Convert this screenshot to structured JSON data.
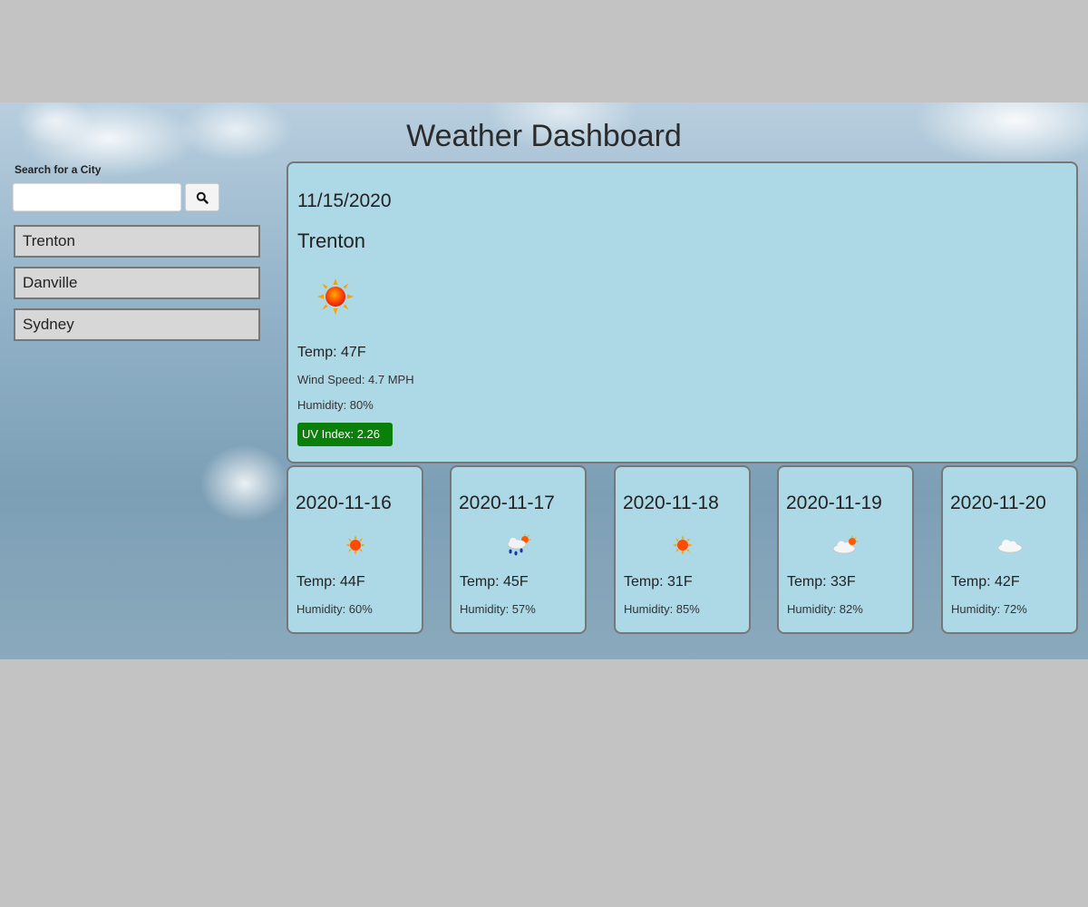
{
  "header": {
    "title": "Weather Dashboard"
  },
  "search": {
    "label": "Search for a City",
    "value": "",
    "placeholder": ""
  },
  "history": [
    "Trenton",
    "Danville",
    "Sydney"
  ],
  "current": {
    "date": "11/15/2020",
    "city": "Trenton",
    "icon": "sun-icon",
    "temp": "Temp: 47F",
    "wind": "Wind Speed: 4.7 MPH",
    "humidity": "Humidity: 80%",
    "uv": "UV Index: 2.26",
    "uv_color": "#0a7f0a"
  },
  "forecast": [
    {
      "date": "2020-11-16",
      "icon": "sun-icon",
      "temp": "Temp: 44F",
      "humidity": "Humidity: 60%"
    },
    {
      "date": "2020-11-17",
      "icon": "rain-cloud-sun-icon",
      "temp": "Temp: 45F",
      "humidity": "Humidity: 57%"
    },
    {
      "date": "2020-11-18",
      "icon": "sun-icon",
      "temp": "Temp: 31F",
      "humidity": "Humidity: 85%"
    },
    {
      "date": "2020-11-19",
      "icon": "cloud-sun-icon",
      "temp": "Temp: 33F",
      "humidity": "Humidity: 82%"
    },
    {
      "date": "2020-11-20",
      "icon": "cloud-icon",
      "temp": "Temp: 42F",
      "humidity": "Humidity: 72%"
    }
  ],
  "colors": {
    "card_bg": "#add8e6",
    "border": "#777777",
    "history_bg": "#d7d7d7"
  }
}
